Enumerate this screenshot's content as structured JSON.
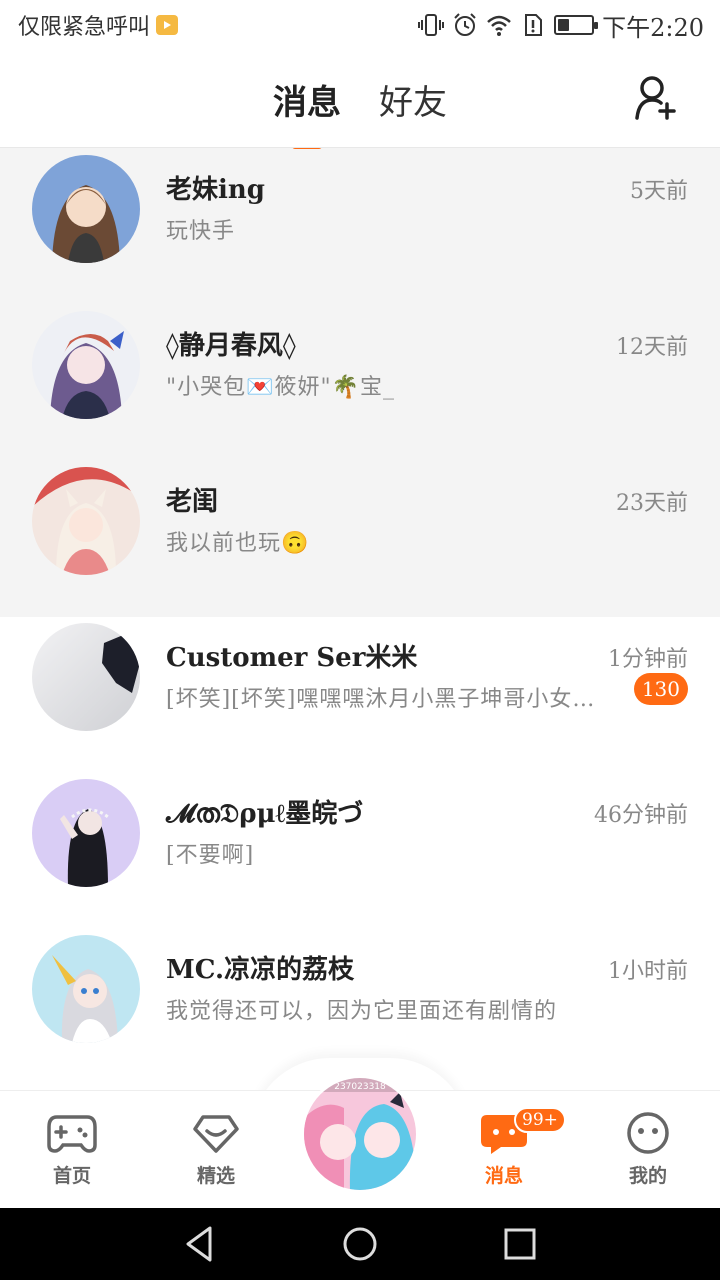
{
  "status_bar": {
    "carrier_text": "仅限紧急呼叫",
    "time": "下午2:20",
    "battery_level": 0.35
  },
  "header": {
    "tabs": [
      {
        "label": "消息",
        "active": true
      },
      {
        "label": "好友",
        "active": false
      }
    ],
    "add_friend_icon": "add-user-icon"
  },
  "conversations": [
    {
      "name": "老妹ing",
      "preview": "玩快手",
      "time": "5天前",
      "unread": null,
      "highlighted": true
    },
    {
      "name": "◊静月春风◊",
      "preview": "\"小哭包💌筱妍\"🌴宝_",
      "time": "12天前",
      "unread": null,
      "highlighted": true
    },
    {
      "name": "老闺",
      "preview": "我以前也玩🙃",
      "time": "23天前",
      "unread": null,
      "highlighted": true
    },
    {
      "name": "Customer Ser米米",
      "preview": "[坏笑][坏笑]嘿嘿嘿沐月小黑子坤哥小女…",
      "time": "1分钟前",
      "unread": "130",
      "highlighted": false
    },
    {
      "name": "𝓜ത𝔇ρμℓ墨皖づ",
      "preview": "[不要啊]",
      "time": "46分钟前",
      "unread": null,
      "highlighted": false
    },
    {
      "name": "MC.凉凉的荔枝",
      "preview": "我觉得还可以，因为它里面还有剧情的",
      "time": "1小时前",
      "unread": null,
      "highlighted": false
    }
  ],
  "bottom_nav": {
    "items": [
      {
        "label": "首页",
        "icon": "gamepad-icon"
      },
      {
        "label": "精选",
        "icon": "heart-diamond-icon"
      },
      {
        "label": "消息",
        "icon": "chat-bubble-icon",
        "active": true,
        "badge": "99+"
      },
      {
        "label": "我的",
        "icon": "face-icon"
      }
    ],
    "center_avatar_id_text": "237023318"
  },
  "colors": {
    "accent": "#ff6a13",
    "text_primary": "#222222",
    "text_secondary": "#888888"
  }
}
